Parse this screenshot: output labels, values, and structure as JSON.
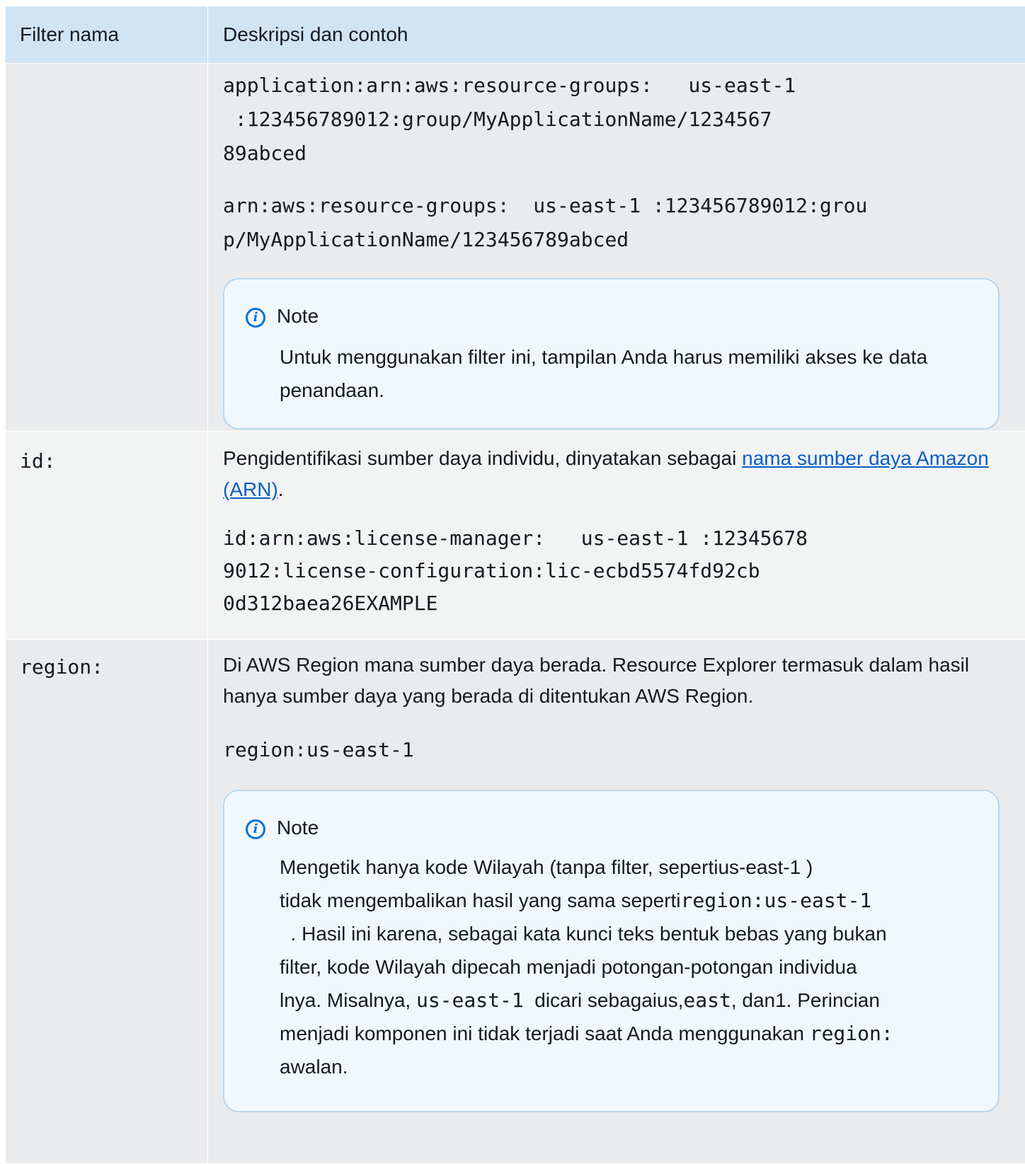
{
  "header": {
    "col_name": "Filter nama",
    "col_desc": "Deskripsi dan contoh"
  },
  "row_application": {
    "example1": "application:arn:aws:resource-groups:   us-east-1\n :123456789012:group/MyApplicationName/1234567\n89abced",
    "example2": "arn:aws:resource-groups:  us-east-1 :123456789012:grou\np/MyApplicationName/123456789abced",
    "note": {
      "title": "Note",
      "body": "Untuk menggunakan filter ini, tampilan Anda harus memiliki akses ke data penandaan."
    }
  },
  "row_id": {
    "name": "id:",
    "desc_before": "Pengidentifikasi sumber daya individu, dinyatakan sebagai ",
    "desc_link": "nama sumber daya Amazon (ARN)",
    "desc_after": ".",
    "example": "id:arn:aws:license-manager:   us-east-1 :12345678\n9012:license-configuration:lic-ecbd5574fd92cb\n0d312baea26EXAMPLE"
  },
  "row_region": {
    "name": "region:",
    "desc": "Di AWS Region mana sumber daya berada. Resource Explorer termasuk dalam hasil hanya sumber daya yang berada di ditentukan AWS Region.",
    "example": "region:us-east-1",
    "note": {
      "title": "Note",
      "p1": "Mengetik hanya kode Wilayah (tanpa filter, sepertius-east-1 )",
      "p2a": "tidak mengembalikan hasil yang sama seperti",
      "p2b": "region:us-east-1",
      "p3": "  . Hasil ini karena, sebagai kata kunci teks bentuk bebas yang bukan",
      "p4": "filter, kode Wilayah dipecah menjadi potongan-potongan individua",
      "p5a": "lnya. Misalnya, ",
      "p5b": "us-east-1",
      "p5c": "  dicari sebagaius,",
      "p5d": "east",
      "p5e": ", dan1. Perincian",
      "p6a": "menjadi komponen ini tidak terjadi saat Anda menggunakan ",
      "p6b": "region:",
      "p7": "awalan."
    }
  }
}
